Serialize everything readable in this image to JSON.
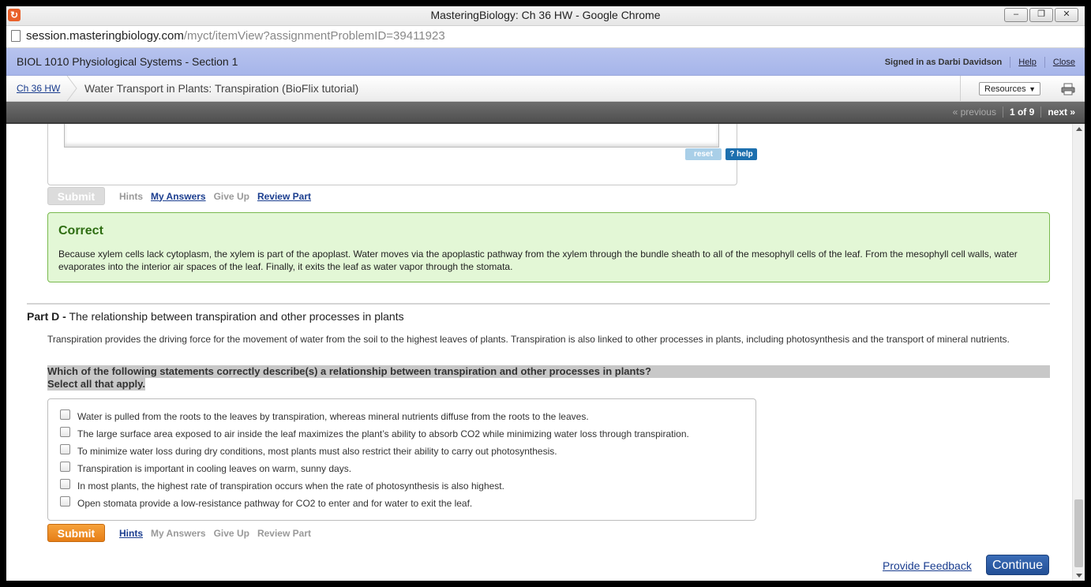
{
  "window": {
    "title": "MasteringBiology: Ch 36 HW - Google Chrome",
    "controls": [
      "minimize",
      "restore",
      "close"
    ]
  },
  "address": {
    "host": "session.masteringbiology.com",
    "path": "/myct/itemView?assignmentProblemID=39411923"
  },
  "course_bar": {
    "course": "BIOL 1010 Physiological Systems - Section 1",
    "signed_in": "Signed in as Darbi Davidson",
    "help": "Help",
    "close": "Close"
  },
  "crumb": {
    "assignment_link": "Ch 36 HW",
    "item_title": "Water Transport in Plants: Transpiration (BioFlix tutorial)",
    "resources": "Resources",
    "print_icon": "printer-icon"
  },
  "nav": {
    "previous": "« previous",
    "position": "1 of 9",
    "next": "next »"
  },
  "part_c": {
    "reset": "reset",
    "help": "? help",
    "submit": "Submit",
    "hints": "Hints",
    "my_answers": "My Answers",
    "give_up": "Give Up",
    "review_part": "Review Part",
    "correct_heading": "Correct",
    "correct_text": "Because xylem cells lack cytoplasm, the xylem is part of the apoplast. Water moves via the apoplastic pathway from the xylem through the bundle sheath to all of the mesophyll cells of the leaf. From the mesophyll cell walls, water evaporates into the interior air spaces of the leaf. Finally, it exits the leaf as water vapor through the stomata."
  },
  "part_d": {
    "label": "Part D -",
    "title": "The relationship between transpiration and other processes in plants",
    "intro": "Transpiration provides the driving force for the movement of water from the soil to the highest leaves of plants. Transpiration is also linked to other processes in plants, including photosynthesis and the transport of mineral nutrients.",
    "question": "Which of the following statements correctly describe(s) a relationship between transpiration and other processes in plants?",
    "instruction": "Select all that apply.",
    "options": [
      "Water is pulled from the roots to the leaves by transpiration, whereas mineral nutrients diffuse from the roots to the leaves.",
      "The large surface area exposed to air inside the leaf maximizes the plant’s ability to absorb CO2 while minimizing water loss through transpiration.",
      "To minimize water loss during dry conditions, most plants must also restrict their ability to carry out photosynthesis.",
      "Transpiration is important in cooling leaves on warm, sunny days.",
      "In most plants, the highest rate of transpiration occurs when the rate of photosynthesis is also highest.",
      "Open stomata provide a low-resistance pathway for CO2 to enter and for water to exit the leaf."
    ],
    "submit": "Submit",
    "hints": "Hints",
    "my_answers": "My Answers",
    "give_up": "Give Up",
    "review_part": "Review Part"
  },
  "footer": {
    "feedback": "Provide Feedback",
    "continue": "Continue"
  },
  "colors": {
    "course_bar": "#aebbec",
    "submit_active": "#ee8b22",
    "correct_bg": "#e3f7d6",
    "correct_border": "#79b94e",
    "link": "#1a3d8f",
    "continue_bg": "#2d5ca6"
  }
}
